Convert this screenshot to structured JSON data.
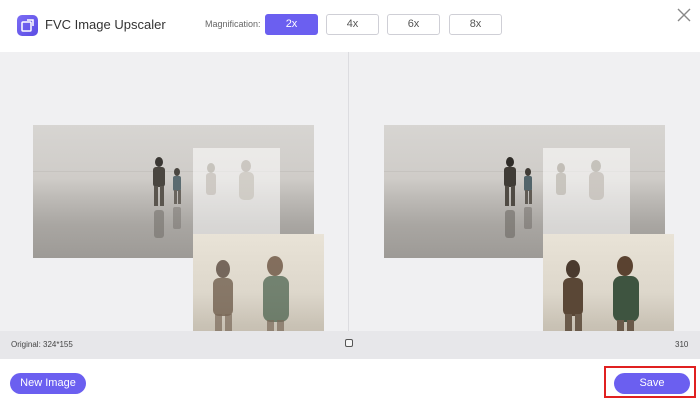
{
  "app": {
    "title": "FVC Image Upscaler"
  },
  "magnification": {
    "label": "Magnification:",
    "options": [
      "2x",
      "4x",
      "6x",
      "8x"
    ],
    "selected": "2x"
  },
  "preview": {
    "original_info": "Original: 324*155",
    "output_info": "310"
  },
  "footer": {
    "new_image_label": "New Image",
    "save_label": "Save"
  },
  "colors": {
    "accent": "#6b5ff0",
    "highlight": "#e02020"
  },
  "icons": {
    "logo": "upscaler-logo-icon",
    "close": "close-icon",
    "handle": "compare-handle-icon"
  }
}
